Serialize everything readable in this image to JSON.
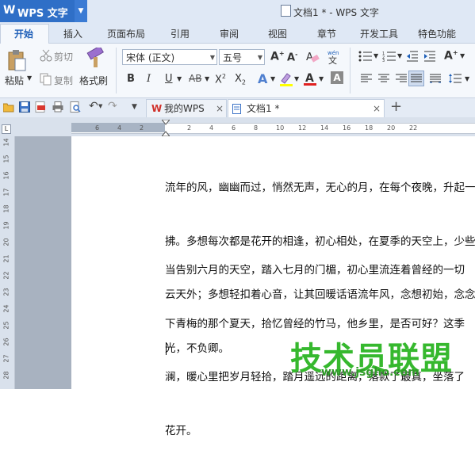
{
  "app": {
    "logo_text": "WPS 文字",
    "document_title": "文档1 * - WPS 文字"
  },
  "ribbon_tabs": [
    "开始",
    "插入",
    "页面布局",
    "引用",
    "审阅",
    "视图",
    "章节",
    "开发工具",
    "特色功能"
  ],
  "clipboard": {
    "cut": "剪切",
    "copy": "复制",
    "paste": "粘贴",
    "format_painter": "格式刷"
  },
  "font": {
    "name": "宋体 (正文)",
    "size": "五号"
  },
  "doc_tabs": [
    {
      "label": "我的WPS"
    },
    {
      "label": "文档1 *"
    }
  ],
  "ruler": {
    "h_numbers": [
      "6",
      "4",
      "2",
      "2",
      "4",
      "6",
      "8",
      "10",
      "12",
      "14",
      "16",
      "18",
      "20",
      "22"
    ],
    "v_numbers": [
      "14",
      "15",
      "16",
      "17",
      "18",
      "19",
      "20",
      "21",
      "22",
      "23",
      "24",
      "25",
      "26",
      "27",
      "28"
    ]
  },
  "document": {
    "paragraph1": [
      "流年的风，幽幽而过，悄然无声，无心的月，在每个夜晚，升起一",
      "拂。多想每次都是花开的相逢，初心相处，在夏季的天空上，少些",
      "云天外；多想轻扣着心音，让其回暖话语流年风，念想初始，念念",
      "光，不负卿。"
    ],
    "paragraph2": [
      "当告别六月的天空，踏入七月的门楣，初心里流连着曾经的一切",
      "下青梅的那个夏天，拾忆曾经的竹马，他乡里，是否可好？这季",
      "澜，暖心里把岁月轻拾，踏月遥远的距离，落款了最真，坐落了",
      "花开。"
    ]
  },
  "watermark": {
    "text": "技术员联盟",
    "url": "www.jsgho.com"
  },
  "colors": {
    "title_blue": "#2f6fc7",
    "watermark_green": "#36b82e"
  }
}
